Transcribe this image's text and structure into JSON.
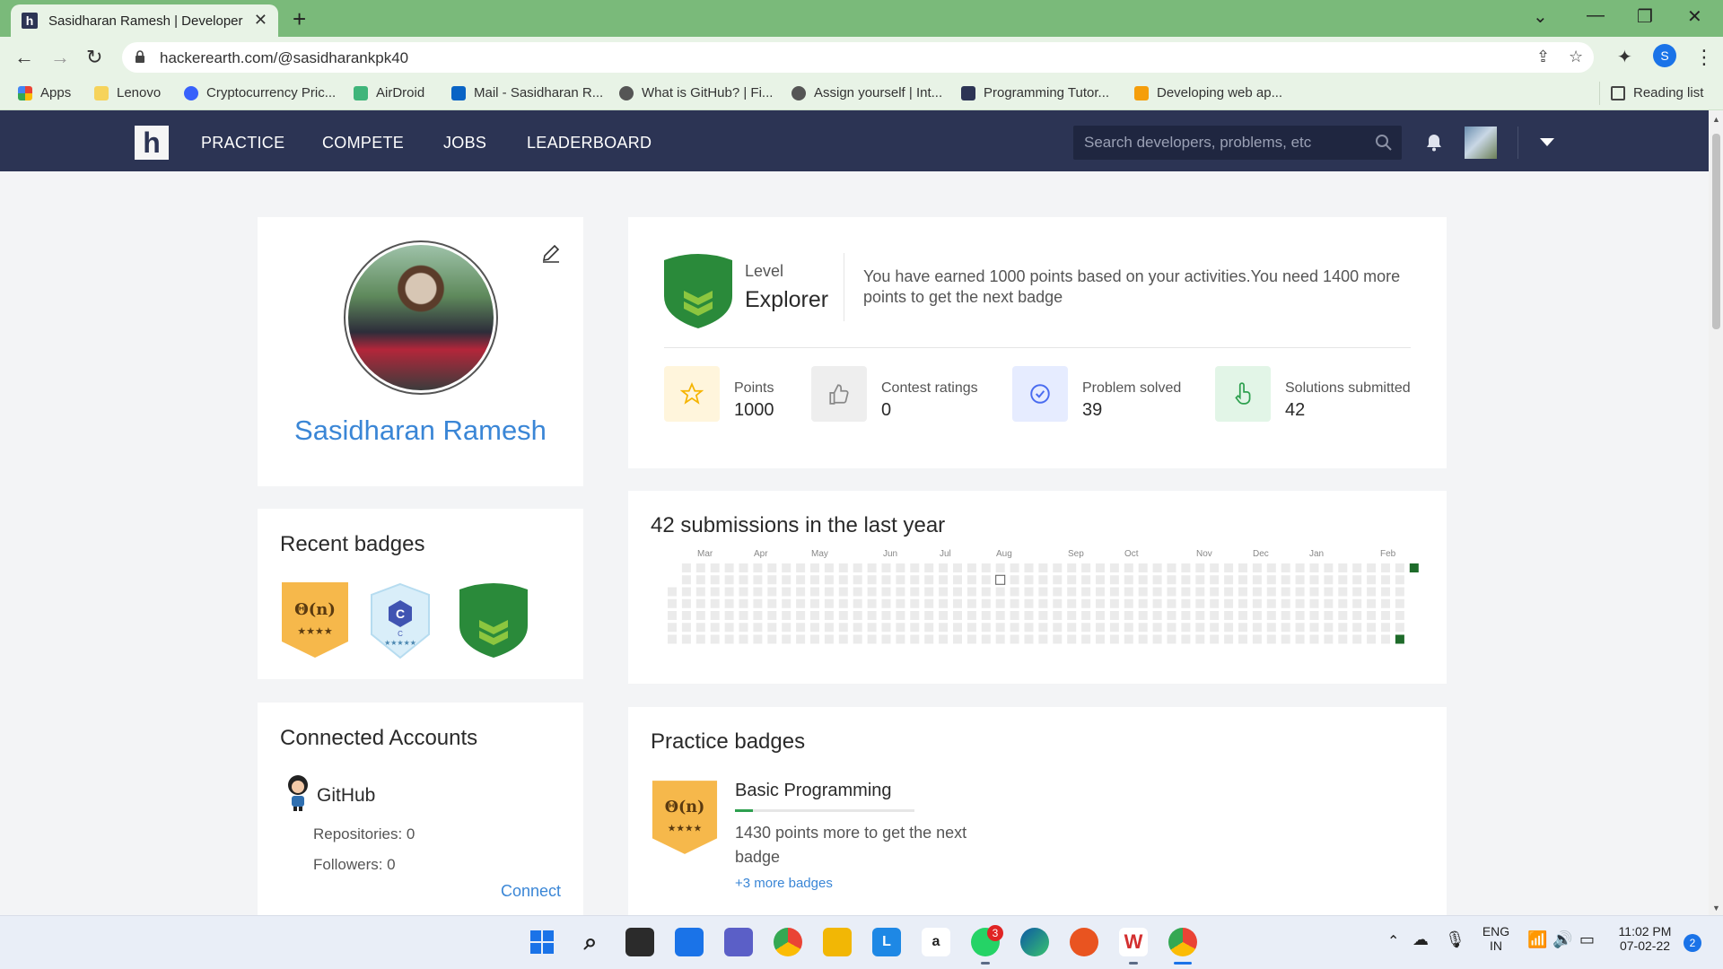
{
  "browser": {
    "tab_title": "Sasidharan Ramesh | Developer P",
    "url": "hackerearth.com/@sasidharankpk40",
    "profile_initial": "S",
    "bookmarks": [
      "Apps",
      "Lenovo",
      "Cryptocurrency Pric...",
      "AirDroid",
      "Mail - Sasidharan R...",
      "What is GitHub? | Fi...",
      "Assign yourself | Int...",
      "Programming Tutor...",
      "Developing web ap..."
    ],
    "reading_list": "Reading list"
  },
  "header": {
    "logo": "h",
    "menu": [
      "PRACTICE",
      "COMPETE",
      "JOBS",
      "LEADERBOARD"
    ],
    "search_placeholder": "Search developers, problems, etc"
  },
  "profile": {
    "name": "Sasidharan Ramesh"
  },
  "recent_badges": {
    "title": "Recent badges",
    "badges": [
      {
        "glyph": "Θ(n)",
        "stars": "★★★★"
      },
      {
        "glyph": "C",
        "sub": "C",
        "stars": "★★★★★"
      },
      {
        "glyph": ""
      }
    ]
  },
  "level": {
    "label": "Level",
    "value": "Explorer",
    "message": "You have earned 1000 points based on your activities.You need 1400 more points to get the next badge"
  },
  "stats": [
    {
      "label": "Points",
      "value": "1000",
      "color": "#f5b400",
      "bg": "#fff5dc"
    },
    {
      "label": "Contest ratings",
      "value": "0",
      "color": "#888888",
      "bg": "#eeeeee"
    },
    {
      "label": "Problem solved",
      "value": "39",
      "color": "#4a6cf0",
      "bg": "#e6ecff"
    },
    {
      "label": "Solutions submitted",
      "value": "42",
      "color": "#2ea04f",
      "bg": "#e2f5e7"
    }
  ],
  "submissions": {
    "title": "42 submissions in the last year",
    "months": [
      "Mar",
      "Apr",
      "May",
      "Jun",
      "Jul",
      "Aug",
      "Sep",
      "Oct",
      "Nov",
      "Dec",
      "Jan",
      "Feb"
    ]
  },
  "practice": {
    "title": "Practice badges",
    "badge_name": "Basic Programming",
    "badge_glyph": "Θ(n)",
    "badge_stars": "★★★★",
    "progress": 0.1,
    "message": "1430 points more to get the next badge",
    "more": "+3 more badges"
  },
  "accounts": {
    "title": "Connected Accounts",
    "service": "GitHub",
    "repos": "Repositories: 0",
    "followers": "Followers: 0",
    "connect": "Connect"
  },
  "taskbar": {
    "whatsapp_badge": "3",
    "lang_top": "ENG",
    "lang_bottom": "IN",
    "time": "11:02 PM",
    "date": "07-02-22",
    "notifications": "2"
  }
}
